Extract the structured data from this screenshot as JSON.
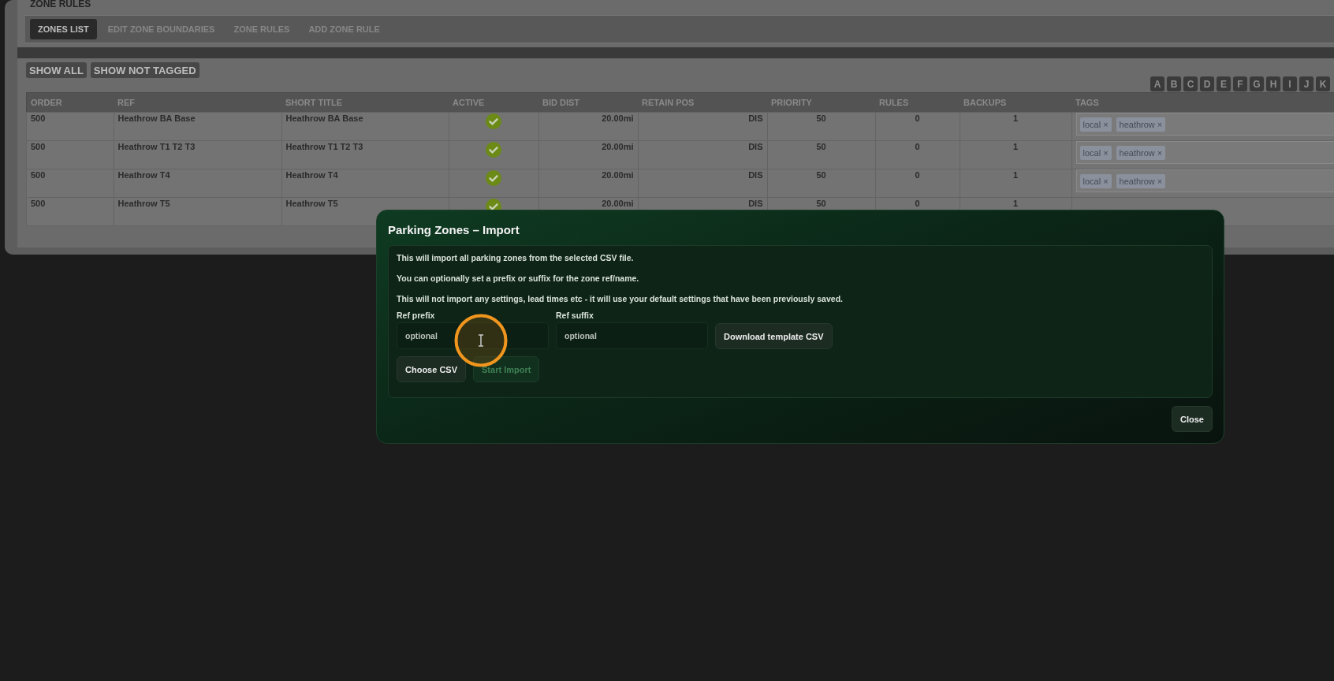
{
  "page_title": "ZONE RULES",
  "tabs": [
    {
      "label": "ZONES LIST",
      "selected": true
    },
    {
      "label": "EDIT ZONE BOUNDARIES",
      "selected": false
    },
    {
      "label": "ZONE RULES",
      "selected": false
    },
    {
      "label": "ADD ZONE RULE",
      "selected": false
    }
  ],
  "filter_buttons": [
    "SHOW ALL",
    "SHOW NOT TAGGED"
  ],
  "letters": [
    "A",
    "B",
    "C",
    "D",
    "E",
    "F",
    "G",
    "H",
    "I",
    "J",
    "K"
  ],
  "table": {
    "columns": [
      "ORDER",
      "REF",
      "SHORT TITLE",
      "ACTIVE",
      "BID DIST",
      "RETAIN POS",
      "PRIORITY",
      "RULES",
      "BACKUPS",
      "TAGS"
    ],
    "rows": [
      {
        "order": "500",
        "ref": "Heathrow BA Base",
        "short_title": "Heathrow BA Base",
        "active": true,
        "bid_dist": "20.00mi",
        "retain_pos": "DIS",
        "priority": "50",
        "rules": "0",
        "backups": "1",
        "tags": [
          {
            "label": "local",
            "remove": "×"
          },
          {
            "label": "heathrow",
            "remove": "×"
          }
        ]
      },
      {
        "order": "500",
        "ref": "Heathrow T1 T2 T3",
        "short_title": "Heathrow T1 T2 T3",
        "active": true,
        "bid_dist": "20.00mi",
        "retain_pos": "DIS",
        "priority": "50",
        "rules": "0",
        "backups": "1",
        "tags": [
          {
            "label": "local",
            "remove": "×"
          },
          {
            "label": "heathrow",
            "remove": "×"
          }
        ]
      },
      {
        "order": "500",
        "ref": "Heathrow T4",
        "short_title": "Heathrow T4",
        "active": true,
        "bid_dist": "20.00mi",
        "retain_pos": "DIS",
        "priority": "50",
        "rules": "0",
        "backups": "1",
        "tags": [
          {
            "label": "local",
            "remove": "×"
          },
          {
            "label": "heathrow",
            "remove": "×"
          }
        ]
      },
      {
        "order": "500",
        "ref": "Heathrow T5",
        "short_title": "Heathrow T5",
        "active": true,
        "bid_dist": "20.00mi",
        "retain_pos": "DIS",
        "priority": "50",
        "rules": "0",
        "backups": "1"
      }
    ]
  },
  "dialog": {
    "title": "Parking Zones – Import",
    "paragraphs": [
      "This will import all parking zones from the selected CSV file.",
      "You can optionally set a prefix or suffix for the zone ref/name.",
      "This will not import any settings, lead times etc - it will use your default settings that have been previously saved."
    ],
    "fields": [
      {
        "label": "Ref prefix",
        "placeholder": "optional"
      },
      {
        "label": "Ref suffix",
        "placeholder": "optional"
      }
    ],
    "download_button": {
      "label": "Download template CSV",
      "disabled": false
    },
    "actions": [
      {
        "label": "Choose CSV",
        "disabled": false
      },
      {
        "label": "Start Import",
        "disabled": true
      }
    ],
    "close_button": {
      "label": "Close",
      "disabled": false
    }
  }
}
